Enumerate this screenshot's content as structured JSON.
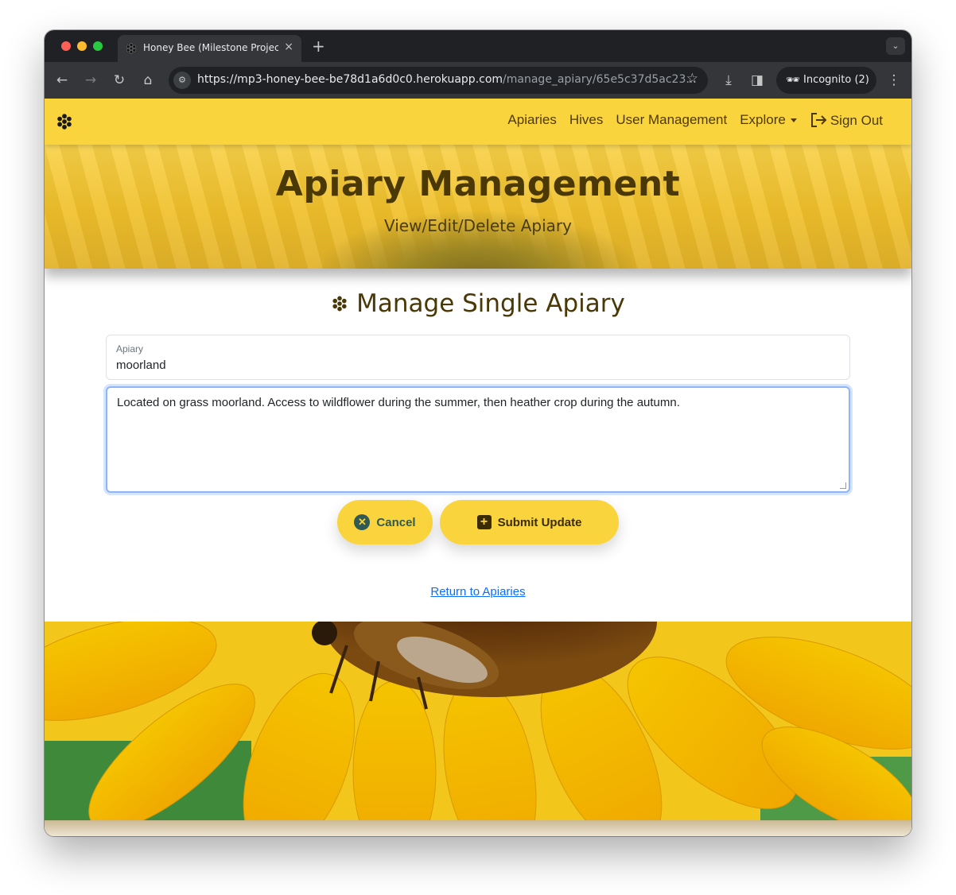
{
  "browser": {
    "tab_title": "Honey Bee (Milestone Project",
    "tab_close": "×",
    "new_tab": "+",
    "url_main": "https://mp3-honey-bee-be78d1a6d0c0.herokuapp.com",
    "url_path": "/manage_apiary/65e5c37d5ac23...",
    "incognito_label": "Incognito (2)",
    "traffic_lights": [
      "#ff5f57",
      "#febc2e",
      "#28c840"
    ]
  },
  "navbar": {
    "links": [
      "Apiaries",
      "Hives",
      "User Management",
      "Explore"
    ],
    "signout_label": "Sign Out",
    "background": "#fad43d"
  },
  "hero": {
    "title": "Apiary Management",
    "subtitle": "View/Edit/Delete Apiary"
  },
  "main": {
    "heading": "Manage Single Apiary",
    "apiary_field": {
      "label": "Apiary",
      "value": "moorland"
    },
    "description": "Located on grass moorland. Access to wildflower during the summer, then heather crop during the autumn.",
    "cancel_label": "Cancel",
    "submit_label": "Submit Update",
    "return_link": "Return to Apiaries"
  },
  "colors": {
    "accent": "#fad43d",
    "heading_text": "#4a3807",
    "link": "#0d6efd",
    "focus_ring": "#8fb4f8"
  }
}
